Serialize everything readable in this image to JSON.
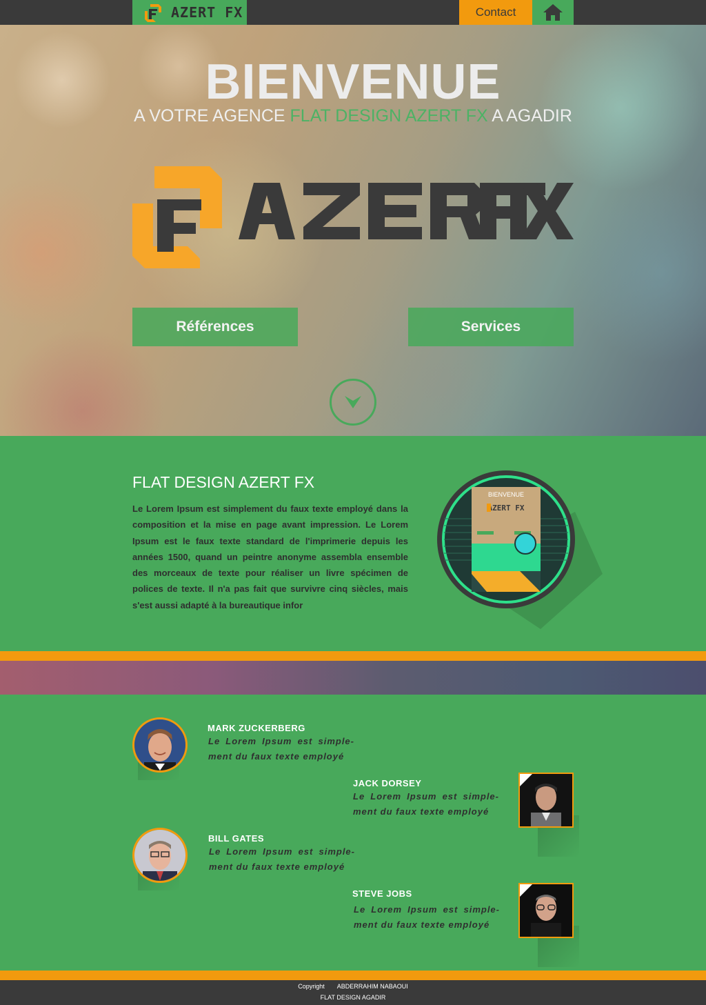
{
  "header": {
    "brand": "AZERT FX",
    "contact_label": "Contact",
    "home_icon": "home-icon"
  },
  "hero": {
    "title": "BIENVENUE",
    "subtitle_prefix": "A VOTRE AGENCE ",
    "subtitle_accent": "FLAT DESIGN AZERT FX",
    "subtitle_suffix": " A AGADIR",
    "logo_text": "AZERT FX",
    "buttons": {
      "references": "Références",
      "services": "Services"
    },
    "scroll_icon": "chevron-down-icon"
  },
  "intro": {
    "title": "FLAT DESIGN AZERT FX",
    "text": "Le Lorem Ipsum est simplement du faux texte employé dans la composition et la mise en page avant impression. Le Lorem Ipsum est le faux texte standard de l'imprimerie depuis les années 1500, quand un peintre anonyme assembla ensemble des morceaux de texte pour réaliser un livre spécimen de polices de texte. Il n'a pas fait que survivre cinq siècles, mais s'est aussi adapté à la bureautique infor",
    "preview": {
      "title": "BIENVENUE",
      "logo": "AZERT FX"
    }
  },
  "testimonials": [
    {
      "name": "MARK ZUCKERBERG",
      "quote": "Le Lorem Ipsum est simple- ment du faux texte employé"
    },
    {
      "name": "JACK DORSEY",
      "quote": "Le Lorem Ipsum est simple- ment du faux texte employé"
    },
    {
      "name": "BILL GATES",
      "quote": "Le Lorem Ipsum est simple- ment du faux texte employé"
    },
    {
      "name": "STEVE JOBS",
      "quote": "Le Lorem Ipsum est simple- ment du faux texte employé"
    }
  ],
  "footer": {
    "copyright": "Copyright",
    "author": "ABDERRAHIM NABAOUI",
    "tagline": "FLAT DESIGN AGADIR"
  },
  "colors": {
    "green": "#48a95b",
    "orange": "#f29a0e",
    "dark": "#3a3a3a"
  }
}
